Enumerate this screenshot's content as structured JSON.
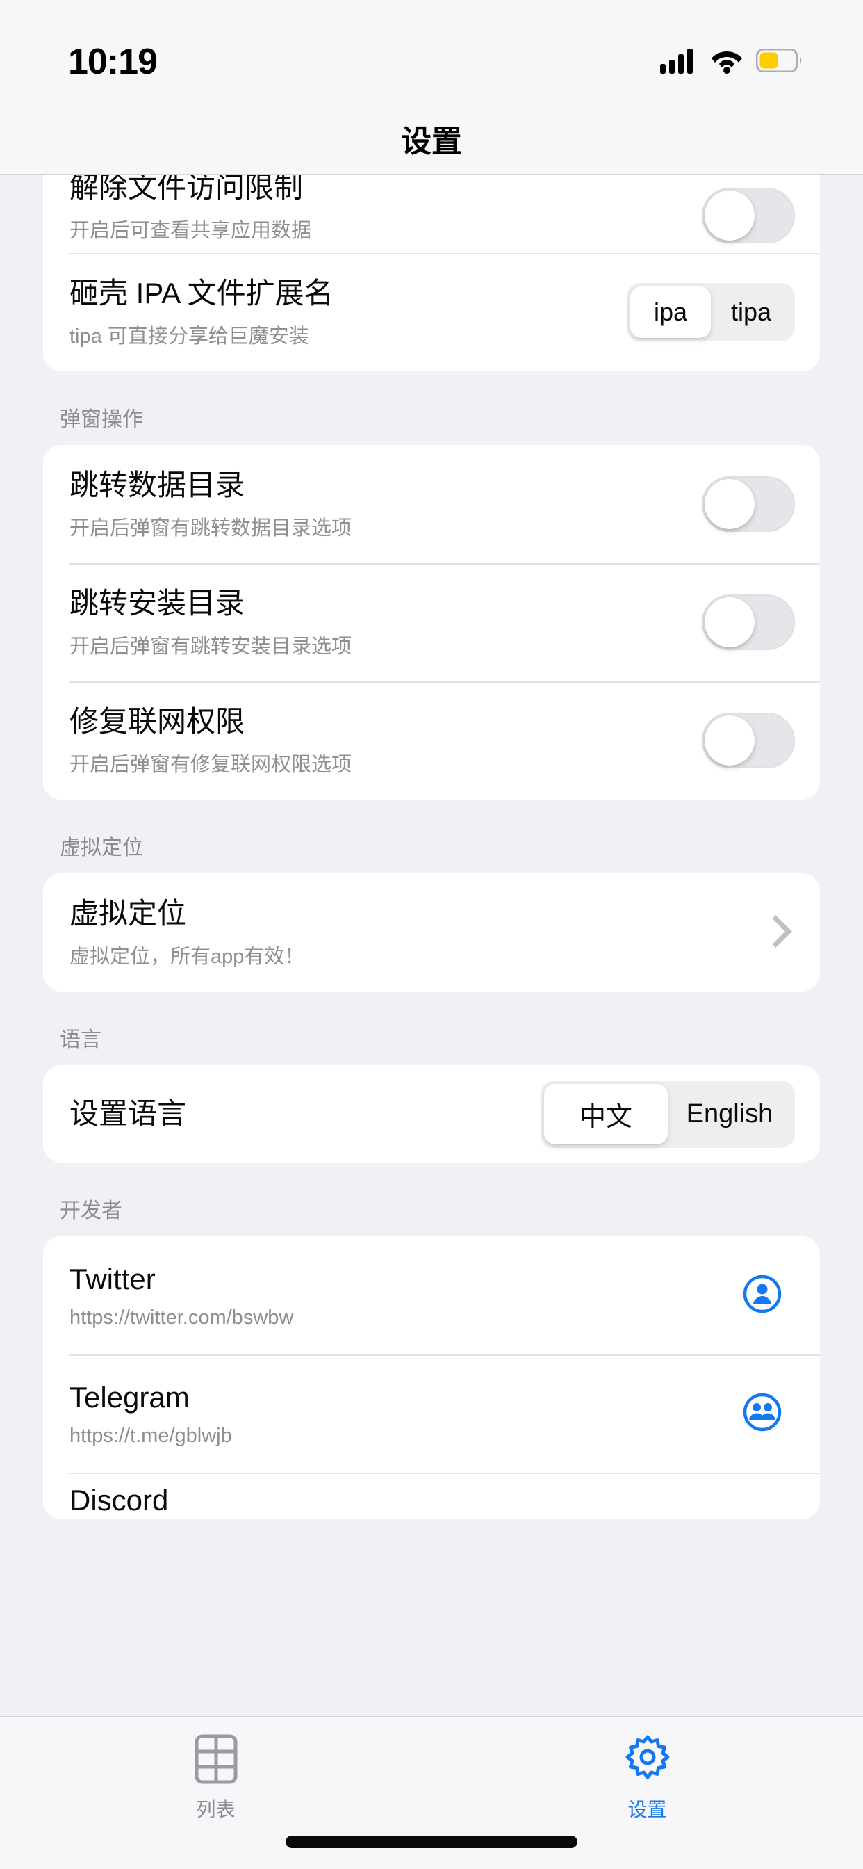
{
  "status_bar": {
    "time": "10:19",
    "cellular_icon": "cellular-signal-icon",
    "wifi_icon": "wifi-icon",
    "battery_icon": "battery-low-power-icon",
    "battery_color": "#ffcc00"
  },
  "nav": {
    "title": "设置"
  },
  "colors": {
    "accent": "#1478f0",
    "page_background": "#f1f1f5",
    "card_background": "#ffffff",
    "secondary_text": "#8e8e93"
  },
  "sections": [
    {
      "header": "",
      "rows": [
        {
          "title": "解除文件访问限制",
          "subtitle": "开启后可查看共享应用数据",
          "control": "toggle",
          "toggle_on": false,
          "clipped": true
        },
        {
          "title": "砸壳 IPA 文件扩展名",
          "subtitle": "tipa 可直接分享给巨魔安装",
          "control": "segmented",
          "options": [
            "ipa",
            "tipa"
          ],
          "selected": "ipa"
        }
      ]
    },
    {
      "header": "弹窗操作",
      "rows": [
        {
          "title": "跳转数据目录",
          "subtitle": "开启后弹窗有跳转数据目录选项",
          "control": "toggle",
          "toggle_on": false
        },
        {
          "title": "跳转安装目录",
          "subtitle": "开启后弹窗有跳转安装目录选项",
          "control": "toggle",
          "toggle_on": false
        },
        {
          "title": "修复联网权限",
          "subtitle": "开启后弹窗有修复联网权限选项",
          "control": "toggle",
          "toggle_on": false
        }
      ]
    },
    {
      "header": "虚拟定位",
      "rows": [
        {
          "title": "虚拟定位",
          "subtitle": "虚拟定位，所有app有效！",
          "control": "chevron"
        }
      ]
    },
    {
      "header": "语言",
      "rows": [
        {
          "title": "设置语言",
          "subtitle": "",
          "control": "segmented",
          "options": [
            "中文",
            "English"
          ],
          "selected": "中文"
        }
      ]
    },
    {
      "header": "开发者",
      "rows": [
        {
          "title": "Twitter",
          "subtitle": "https://twitter.com/bswbw",
          "control": "icon",
          "icon": "person-circle-icon"
        },
        {
          "title": "Telegram",
          "subtitle": "https://t.me/gblwjb",
          "control": "icon",
          "icon": "people-circle-icon"
        },
        {
          "title": "Discord",
          "subtitle": "",
          "control": "none",
          "clipped_bottom": true
        }
      ]
    }
  ],
  "tabbar": {
    "tabs": [
      {
        "label": "列表",
        "icon": "grid-list-icon",
        "active": false
      },
      {
        "label": "设置",
        "icon": "gear-icon",
        "active": true
      }
    ]
  }
}
